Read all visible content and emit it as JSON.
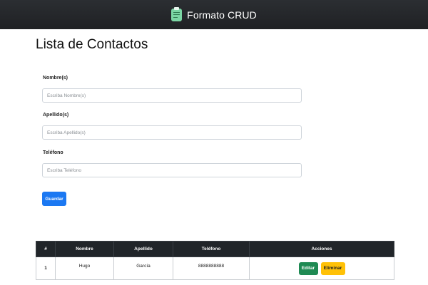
{
  "navbar": {
    "icon": "clipboard-icon",
    "title": "Formato CRUD",
    "colors": {
      "background": "#212529",
      "icon": "#7bd6a4"
    }
  },
  "page": {
    "title": "Lista de Contactos"
  },
  "form": {
    "nombre": {
      "label": "Nombre(s)",
      "placeholder": "Escriba Nombre(s)",
      "value": ""
    },
    "apellido": {
      "label": "Apellido(s)",
      "placeholder": "Escriba Apellido(s)",
      "value": ""
    },
    "telefono": {
      "label": "Teléfono",
      "placeholder": "Escriba Teléfono",
      "value": ""
    },
    "save_label": "Guardar"
  },
  "table": {
    "headers": [
      "#",
      "Nombre",
      "Apellido",
      "Teléfono",
      "Acciones"
    ],
    "rows": [
      {
        "num": "1",
        "nombre": "Hugo",
        "apellido": "García",
        "telefono": "8888888888",
        "edit_label": "Editar",
        "delete_label": "Eliminar"
      }
    ]
  },
  "colors": {
    "primary": "#1b78f2",
    "success": "#1f8a53",
    "warning": "#ffc107",
    "table_header": "#212529"
  }
}
